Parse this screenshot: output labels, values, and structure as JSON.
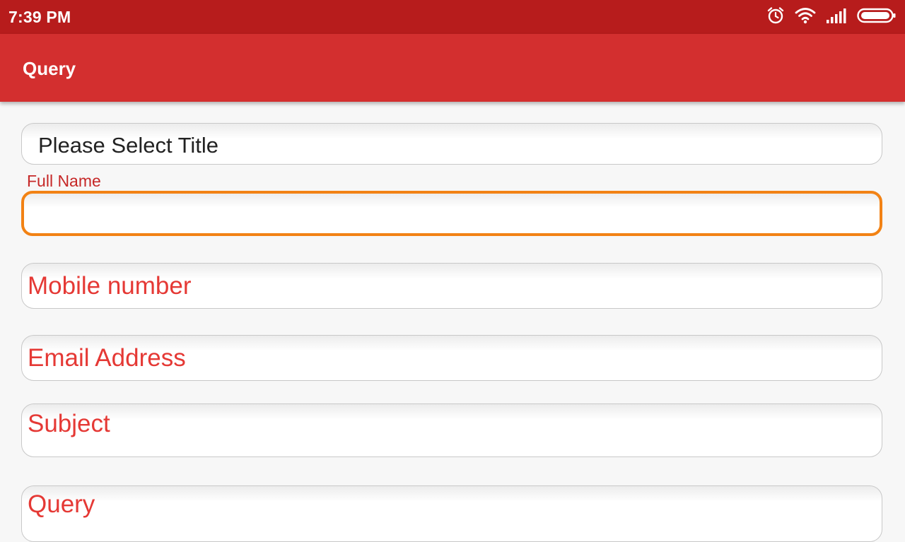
{
  "status_bar": {
    "time": "7:39 PM",
    "icons": [
      "alarm-icon",
      "wifi-icon",
      "signal-icon",
      "battery-icon"
    ]
  },
  "app_bar": {
    "title": "Query"
  },
  "form": {
    "title_select": {
      "value": "Please Select Title"
    },
    "full_name": {
      "label": "Full Name",
      "value": ""
    },
    "mobile": {
      "placeholder": "Mobile number"
    },
    "email": {
      "placeholder": "Email Address"
    },
    "subject": {
      "placeholder": "Subject"
    },
    "query": {
      "placeholder": "Query"
    }
  },
  "colors": {
    "status_bar": "#b71c1c",
    "app_bar": "#d32f2f",
    "hint_text": "#e53935",
    "focus_border": "#f28214"
  }
}
